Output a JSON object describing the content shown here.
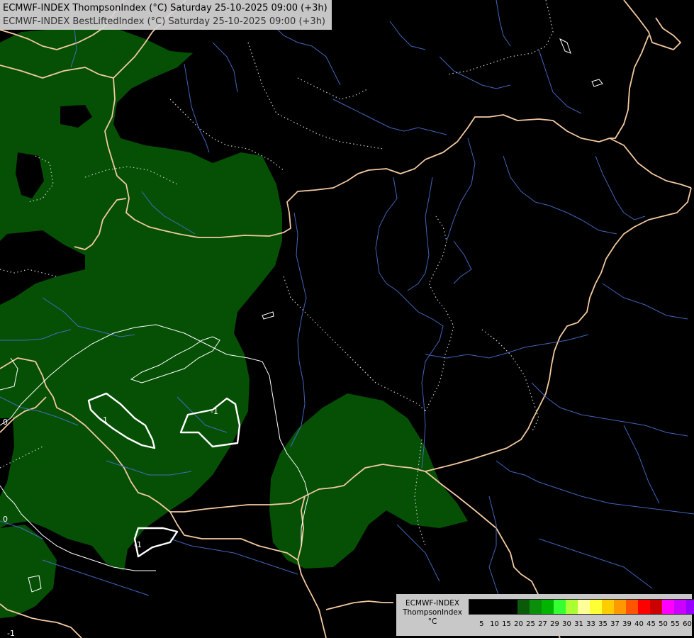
{
  "header": {
    "line1": "ECMWF-INDEX ThompsonIndex (°C) Saturday 25-10-2025 09:00 (+3h)",
    "line2": "ECMWF-INDEX BestLiftedIndex (°C) Saturday 25-10-2025 09:00 (+3h)"
  },
  "map": {
    "contour_labels": [
      "-1",
      "-1",
      "-1",
      "0",
      "0",
      "-1"
    ]
  },
  "legend": {
    "line1": "ECMWF-INDEX",
    "line2": "ThompsonIndex",
    "line3": "°C",
    "swatches": [
      "#000000",
      "#000000",
      "#000000",
      "#000000",
      "#0a5a0a",
      "#0b8f0b",
      "#00b400",
      "#33ff33",
      "#aaff33",
      "#ffff99",
      "#ffff33",
      "#ffcc00",
      "#ff9900",
      "#ff5500",
      "#ff0000",
      "#cc0000",
      "#ff00ff",
      "#cc00ff",
      "#9900ff",
      "#6633ff",
      "#0000ff"
    ],
    "ticks": [
      "5",
      "10",
      "15",
      "20",
      "25",
      "27",
      "29",
      "30",
      "31",
      "33",
      "35",
      "37",
      "39",
      "40",
      "45",
      "50",
      "55",
      "60"
    ]
  }
}
